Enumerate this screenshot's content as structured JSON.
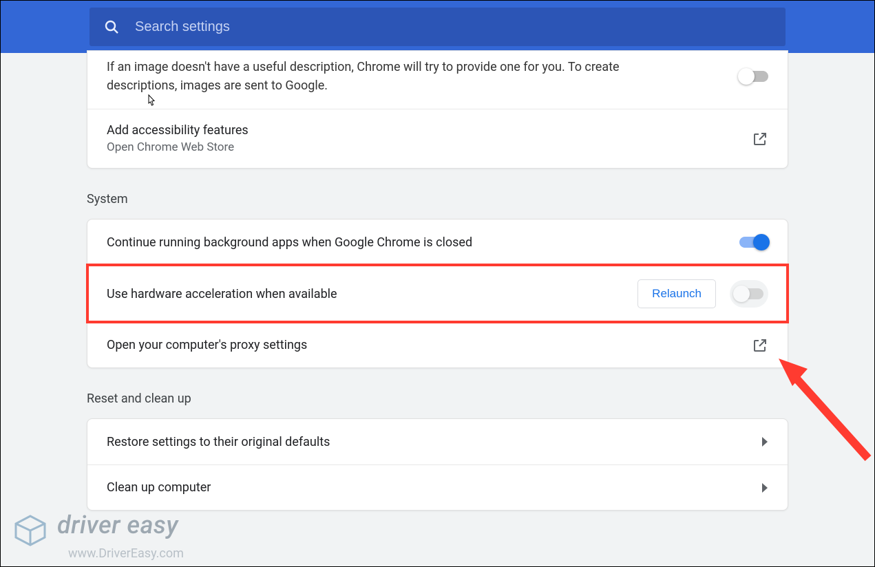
{
  "header": {
    "search_placeholder": "Search settings"
  },
  "accessibility": {
    "desc": "If an image doesn't have a useful description, Chrome will try to provide one for you. To create descriptions, images are sent to Google.",
    "row2_title": "Add accessibility features",
    "row2_sub": "Open Chrome Web Store"
  },
  "system": {
    "label": "System",
    "row1": "Continue running background apps when Google Chrome is closed",
    "row2": "Use hardware acceleration when available",
    "relaunch": "Relaunch",
    "row3": "Open your computer's proxy settings"
  },
  "reset": {
    "label": "Reset and clean up",
    "row1": "Restore settings to their original defaults",
    "row2": "Clean up computer"
  },
  "watermark": {
    "title": "driver easy",
    "sub": "www.DriverEasy.com"
  }
}
